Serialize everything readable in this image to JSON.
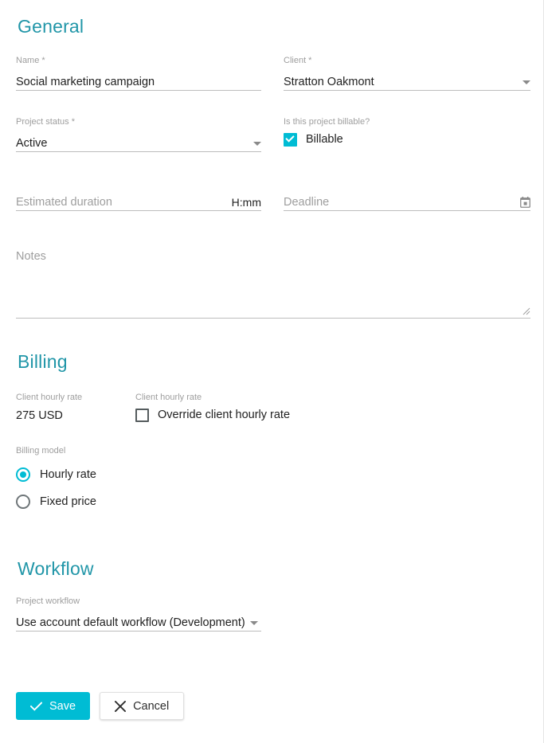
{
  "sections": {
    "general": {
      "title": "General",
      "name": {
        "label": "Name *",
        "value": "Social marketing campaign"
      },
      "client": {
        "label": "Client *",
        "value": "Stratton Oakmont"
      },
      "project_status": {
        "label": "Project status *",
        "value": "Active"
      },
      "billable": {
        "label": "Is this project billable?",
        "checkbox_label": "Billable",
        "checked": true
      },
      "estimated_duration": {
        "label": "",
        "placeholder": "Estimated duration",
        "value": "",
        "suffix": "H:mm"
      },
      "deadline": {
        "placeholder": "Deadline",
        "value": "",
        "icon": "calendar-icon"
      },
      "notes": {
        "placeholder": "Notes",
        "value": ""
      }
    },
    "billing": {
      "title": "Billing",
      "client_hourly_rate": {
        "label": "Client hourly rate",
        "value": "275 USD"
      },
      "override": {
        "label": "Client hourly rate",
        "checkbox_label": "Override client hourly rate",
        "checked": false
      },
      "billing_model": {
        "label": "Billing model",
        "options": [
          {
            "label": "Hourly rate",
            "selected": true
          },
          {
            "label": "Fixed price",
            "selected": false
          }
        ]
      }
    },
    "workflow": {
      "title": "Workflow",
      "project_workflow": {
        "label": "Project workflow",
        "value": "Use account default workflow (Development)"
      }
    }
  },
  "actions": {
    "save_label": "Save",
    "save_icon": "check-icon",
    "cancel_label": "Cancel",
    "cancel_icon": "close-icon"
  },
  "colors": {
    "heading": "#2196a8",
    "accent": "#00bcd4",
    "label": "#9e9e9e",
    "text": "#212121",
    "underline": "#bdbdbd"
  }
}
